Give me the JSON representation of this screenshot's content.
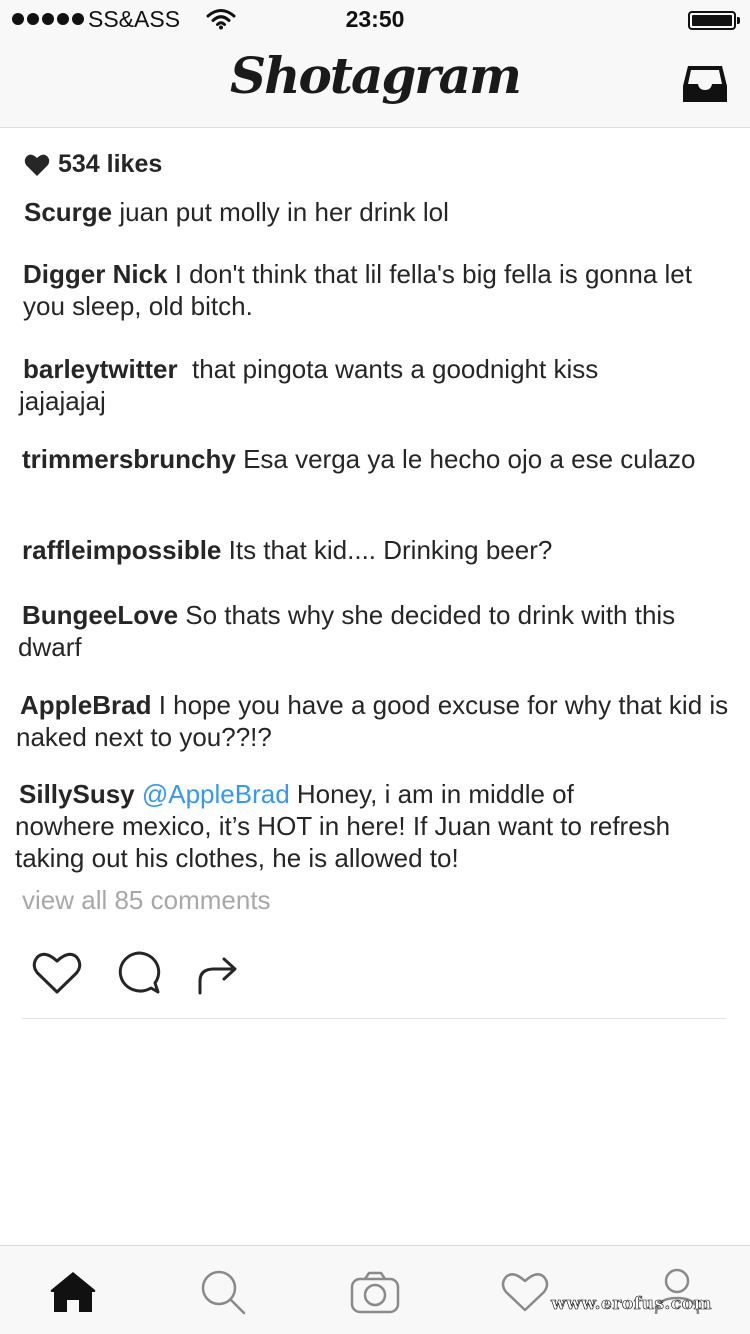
{
  "status_bar": {
    "carrier": "SS&ASS",
    "time": "23:50"
  },
  "header": {
    "logo": "Shotagram",
    "icons": {
      "inbox": "inbox-icon"
    }
  },
  "post": {
    "likes": "534 likes",
    "comments": [
      {
        "user": "Scurge",
        "text": " juan put molly in her drink lol"
      },
      {
        "user": "Digger Nick",
        "text": " I don't think that lil fella's big fella is gonna let you sleep, old bitch."
      },
      {
        "user": "barleytwitter",
        "text": "  that pingota wants a goodnight kiss jajajajaj"
      },
      {
        "user": "trimmersbrunchy",
        "text": " Esa verga ya le hecho ojo a ese culazo"
      },
      {
        "user": "raffleimpossible",
        "text": " Its that kid.... Drinking beer?"
      },
      {
        "user": "BungeeLove",
        "text": " So thats why she decided to drink with this dwarf"
      },
      {
        "user": "AppleBrad",
        "text": " I hope you have a good excuse for why that kid is naked next to you??!?"
      },
      {
        "user": "SillySusy",
        "mention": " @AppleBrad",
        "text": " Honey, i am in middle of nowhere mexico, it’s HOT in here! If Juan want to refresh taking out his clothes, he is allowed to!"
      }
    ],
    "view_all": "view all 85 comments",
    "actions": [
      "heart-icon",
      "comment-icon",
      "share-icon"
    ]
  },
  "tab_bar": {
    "items": [
      "home-icon",
      "search-icon",
      "camera-icon",
      "activity-icon",
      "profile-icon"
    ]
  },
  "watermark": "www.erofus.com",
  "colors": {
    "mention": "#3897f0",
    "muted": "#a8a8a8",
    "bar_bg": "#f8f8f8"
  }
}
